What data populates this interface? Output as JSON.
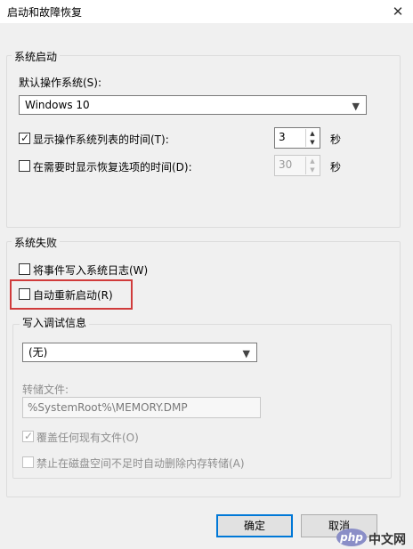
{
  "window": {
    "title": "启动和故障恢复",
    "close_glyph": "✕"
  },
  "system_startup": {
    "group_title": "系统启动",
    "default_os_label": "默认操作系统(S):",
    "default_os_value": "Windows 10",
    "show_os_list": {
      "label": "显示操作系统列表的时间(T):",
      "checked": true,
      "value": "3",
      "unit": "秒"
    },
    "show_recovery": {
      "label": "在需要时显示恢复选项的时间(D):",
      "checked": false,
      "value": "30",
      "unit": "秒"
    }
  },
  "system_failure": {
    "group_title": "系统失败",
    "write_event_log": {
      "label": "将事件写入系统日志(W)",
      "checked": false
    },
    "auto_restart": {
      "label": "自动重新启动(R)",
      "checked": false,
      "highlighted": true
    },
    "debug_info": {
      "group_title": "写入调试信息",
      "dump_type": "(无)",
      "dump_file_label": "转储文件:",
      "dump_file_value": "%SystemRoot%\\MEMORY.DMP",
      "overwrite": {
        "label": "覆盖任何现有文件(O)",
        "checked": true
      },
      "disable_auto_delete": {
        "label": "禁止在磁盘空间不足时自动删除内存转储(A)",
        "checked": false
      }
    }
  },
  "buttons": {
    "ok": "确定",
    "cancel": "取消"
  },
  "watermark": {
    "logo": "php",
    "text": "中文网"
  },
  "colors": {
    "highlight": "#d03b3b",
    "accent": "#0078d7"
  }
}
